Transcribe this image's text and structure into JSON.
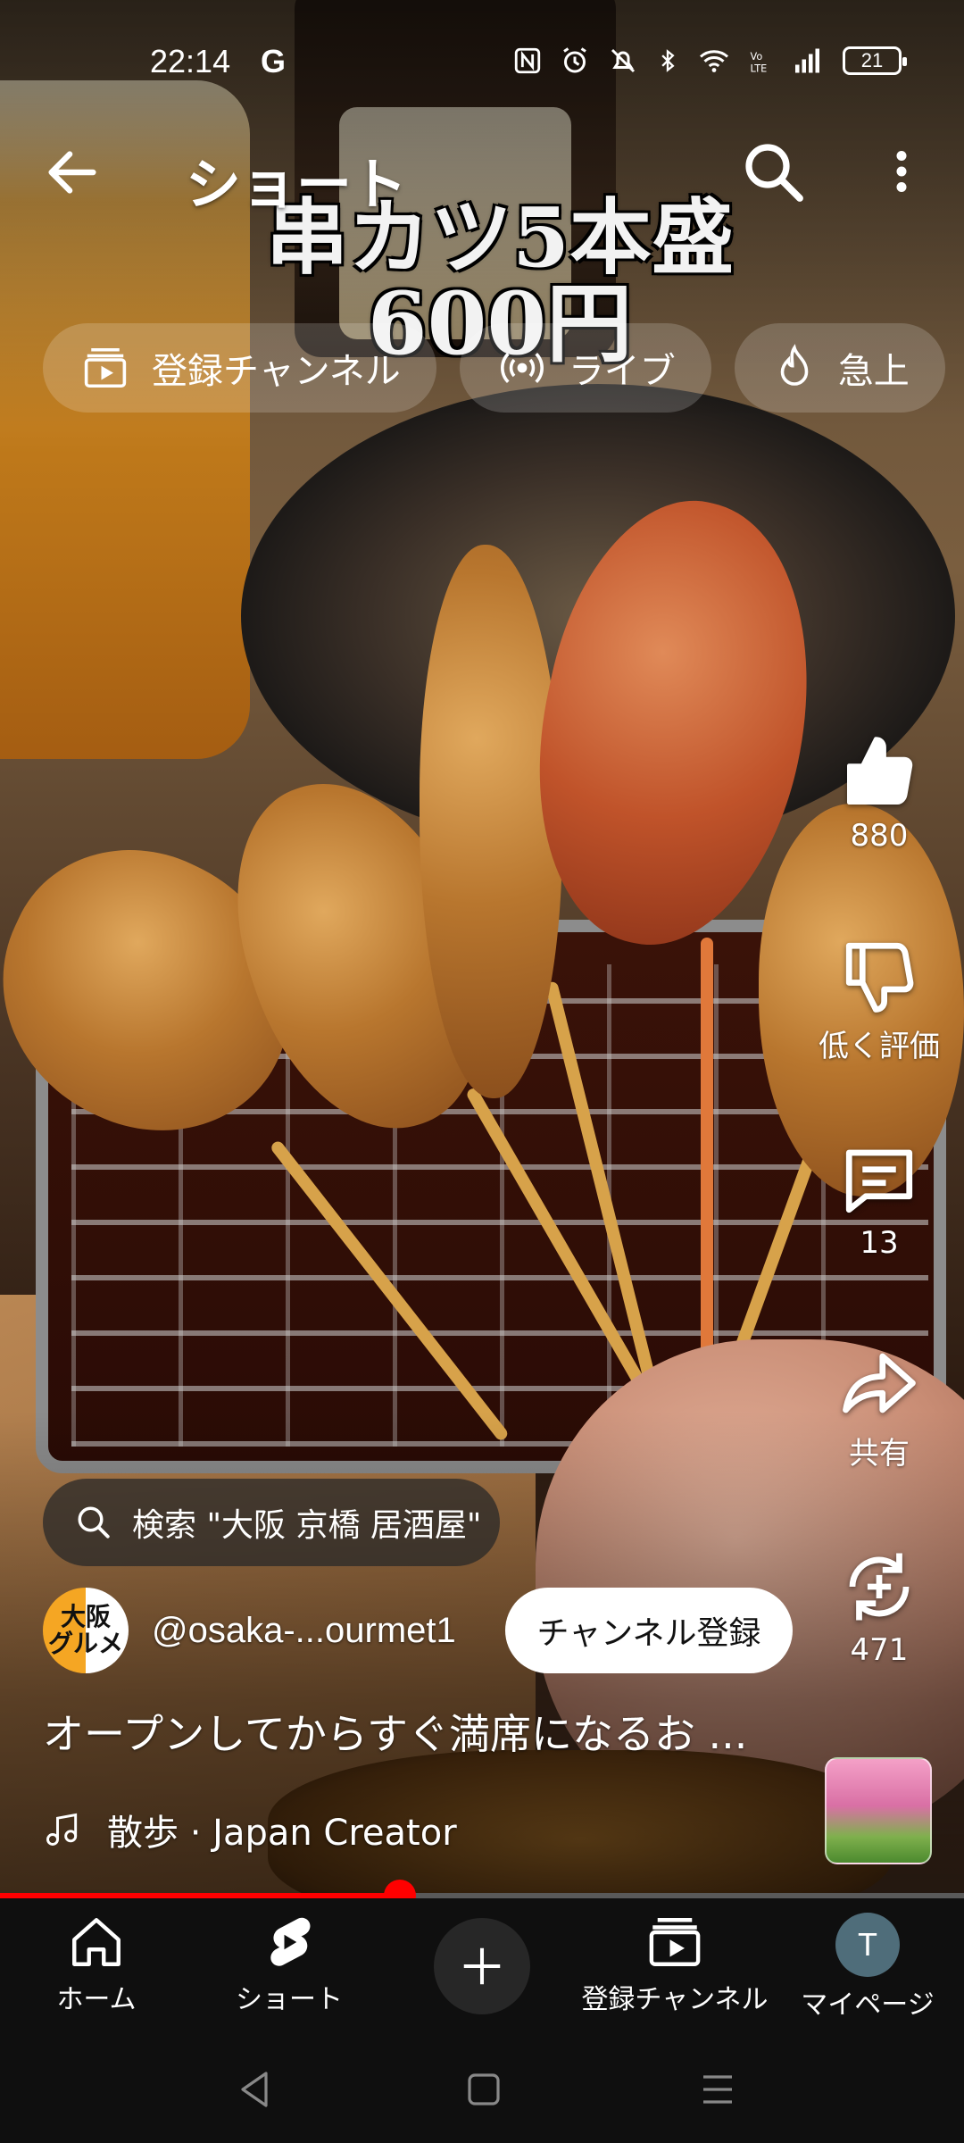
{
  "status_bar": {
    "time": "22:14",
    "g_label": "G",
    "battery": "21"
  },
  "top_bar": {
    "title": "ショート"
  },
  "video_caption": {
    "line1": "串カツ5本盛",
    "line2": "600円"
  },
  "chips": [
    {
      "label": "登録チャンネル",
      "icon": "subscriptions-icon"
    },
    {
      "label": "ライブ",
      "icon": "live-icon"
    },
    {
      "label": "急上",
      "icon": "trending-icon"
    }
  ],
  "actions": {
    "like_count": "880",
    "dislike_label": "低く評価",
    "comment_count": "13",
    "share_label": "共有",
    "remix_count": "471"
  },
  "search_suggestion": "検索 \"大阪 京橋 居酒屋\"",
  "channel": {
    "avatar_text_top": "大阪",
    "avatar_text_bottom": "グルメ",
    "handle": "@osaka-...ourmet1",
    "subscribe_label": "チャンネル登録"
  },
  "description": "オープンしてからすぐ満席になるお ...",
  "music": {
    "track": "散歩 · Japan Creator"
  },
  "progress": {
    "fraction": 0.415,
    "color": "#ff0000"
  },
  "bottom_nav": [
    {
      "label": "ホーム",
      "icon": "home-icon"
    },
    {
      "label": "ショート",
      "icon": "shorts-icon"
    },
    {
      "label": "",
      "icon": "create-plus-icon"
    },
    {
      "label": "登録チャンネル",
      "icon": "subscriptions-icon"
    },
    {
      "label": "マイページ",
      "icon": "profile-avatar",
      "avatar_letter": "T"
    }
  ]
}
